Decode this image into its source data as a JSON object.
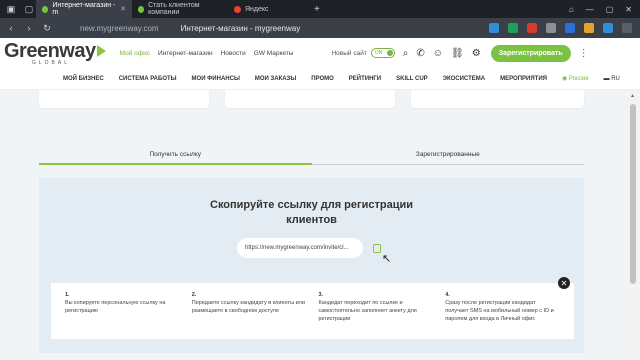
{
  "browser": {
    "tabs": [
      {
        "label": "Интернет-магазин - m",
        "active": true,
        "color": "#7cc242"
      },
      {
        "label": "Стать клиентом компании",
        "active": false,
        "color": "#7cc242"
      },
      {
        "label": "Яндекс",
        "active": false,
        "color": "#e8432b"
      }
    ],
    "url": "new.mygreenway.com",
    "page_title": "Интернет-магазин - mygreenway"
  },
  "header": {
    "logo_main": "Greenway",
    "logo_sub": "GLOBAL",
    "links": [
      {
        "label": "Мой офис",
        "accent": true
      },
      {
        "label": "Интернет-магазин",
        "accent": false
      },
      {
        "label": "Новости",
        "accent": false
      },
      {
        "label": "GW Маркеты",
        "accent": false
      }
    ],
    "new_site_label": "Новый сайт",
    "toggle_label": "ON",
    "register_button": "Зарегистрировать"
  },
  "main_nav": {
    "items": [
      "МОЙ БИЗНЕС",
      "СИСТЕМА РАБОТЫ",
      "МОИ ФИНАНСЫ",
      "МОИ ЗАКАЗЫ",
      "ПРОМО",
      "РЕЙТИНГИ",
      "SKILL CUP",
      "ЭКОСИСТЕМА",
      "МЕРОПРИЯТИЯ"
    ],
    "region": "Россия",
    "lang": "RU"
  },
  "tabs": {
    "get_link": "Получить ссылку",
    "registered": "Зарегистрированные"
  },
  "register_panel": {
    "title_line1": "Скопируйте ссылку для регистрации",
    "title_line2": "клиентов",
    "link_value": "https://new.mygreenway.com/invite/cl..."
  },
  "steps": [
    {
      "num": "1.",
      "text": "Вы копируете персональную ссылку на регистрацию"
    },
    {
      "num": "2.",
      "text": "Передаете ссылку кандидату в клиенты или размещаете в свободном доступе"
    },
    {
      "num": "3.",
      "text": "Кандидат переходит по ссылке и самостоятельно заполняет анкету для регистрации"
    },
    {
      "num": "4.",
      "text": "Сразу после регистрации кандидат получает SMS на мобильный номер с ID и паролем для входа в Личный офис"
    }
  ],
  "colors": {
    "brand_green": "#7cc242",
    "panel_bg": "#e3ecf3"
  }
}
